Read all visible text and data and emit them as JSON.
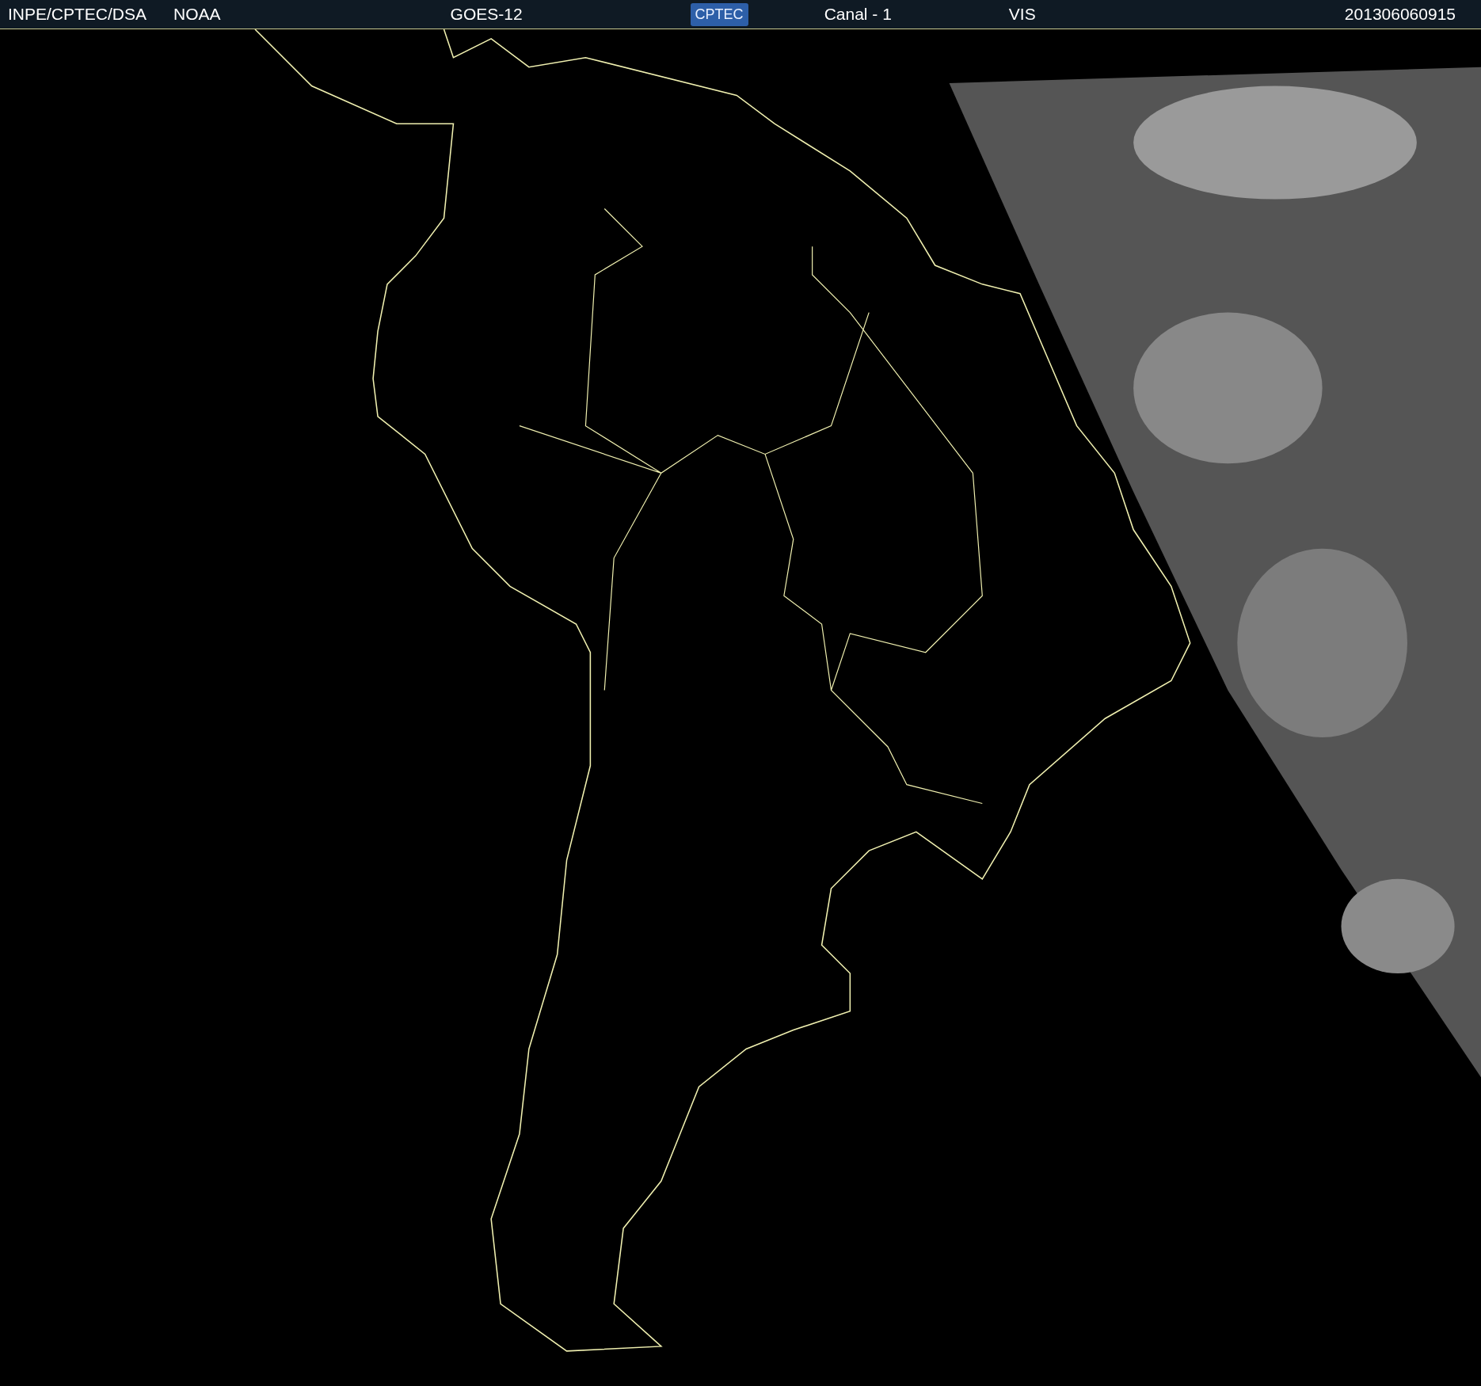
{
  "header": {
    "institution": "INPE/CPTEC/DSA",
    "agency": "NOAA",
    "satellite": "GOES-12",
    "logo": "CPTEC",
    "channel": "Canal - 1",
    "band": "VIS",
    "timestamp": "201306060915"
  }
}
